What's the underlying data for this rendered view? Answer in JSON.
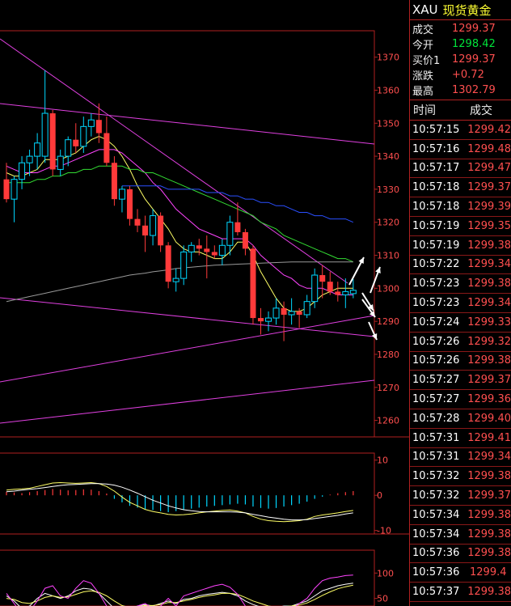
{
  "header": {
    "symbol": "XAU",
    "name": "现货黄金"
  },
  "quote": [
    {
      "label": "成交",
      "value": "1299.37",
      "color": "red"
    },
    {
      "label": "今开",
      "value": "1298.42",
      "color": "green"
    },
    {
      "label": "买价1",
      "value": "1299.37",
      "color": "red"
    },
    {
      "label": "涨跌",
      "value": "+0.72",
      "color": "red"
    },
    {
      "label": "最高",
      "value": "1302.79",
      "color": "red"
    }
  ],
  "ticks_header": {
    "time": "时间",
    "price": "成交"
  },
  "ticks": [
    {
      "time": "10:57:15",
      "price": "1299.42"
    },
    {
      "time": "10:57:16",
      "price": "1299.48"
    },
    {
      "time": "10:57:17",
      "price": "1299.47"
    },
    {
      "time": "10:57:18",
      "price": "1299.37"
    },
    {
      "time": "10:57:18",
      "price": "1299.39"
    },
    {
      "time": "10:57:19",
      "price": "1299.35"
    },
    {
      "time": "10:57:19",
      "price": "1299.38"
    },
    {
      "time": "10:57:22",
      "price": "1299.34"
    },
    {
      "time": "10:57:23",
      "price": "1299.38"
    },
    {
      "time": "10:57:23",
      "price": "1299.34"
    },
    {
      "time": "10:57:24",
      "price": "1299.33"
    },
    {
      "time": "10:57:26",
      "price": "1299.32"
    },
    {
      "time": "10:57:26",
      "price": "1299.38"
    },
    {
      "time": "10:57:27",
      "price": "1299.37"
    },
    {
      "time": "10:57:27",
      "price": "1299.36"
    },
    {
      "time": "10:57:28",
      "price": "1299.40"
    },
    {
      "time": "10:57:31",
      "price": "1299.41"
    },
    {
      "time": "10:57:31",
      "price": "1299.34"
    },
    {
      "time": "10:57:32",
      "price": "1299.38"
    },
    {
      "time": "10:57:32",
      "price": "1299.37"
    },
    {
      "time": "10:57:34",
      "price": "1299.38"
    },
    {
      "time": "10:57:34",
      "price": "1299.38"
    },
    {
      "time": "10:57:36",
      "price": "1299.38"
    },
    {
      "time": "10:57:36",
      "price": "1299.4"
    },
    {
      "time": "10:57:37",
      "price": "1299.38"
    }
  ],
  "colors": {
    "up": "#00d7ff",
    "down": "#ff3a3a",
    "border": "#b02020",
    "trend": "#e040e0",
    "quote_red": "#ff4f4f",
    "quote_green": "#00e43a"
  },
  "chart_data": [
    {
      "type": "candlestick",
      "title": "",
      "ylim": [
        1255,
        1378
      ],
      "y_ticks": [
        1260,
        1270,
        1280,
        1290,
        1300,
        1310,
        1320,
        1330,
        1340,
        1350,
        1360,
        1370
      ],
      "grid": false,
      "candles": [
        {
          "o": 1333,
          "h": 1338,
          "l": 1326,
          "c": 1327
        },
        {
          "o": 1327,
          "h": 1334,
          "l": 1320,
          "c": 1333
        },
        {
          "o": 1333,
          "h": 1340,
          "l": 1330,
          "c": 1338
        },
        {
          "o": 1338,
          "h": 1342,
          "l": 1334,
          "c": 1340
        },
        {
          "o": 1340,
          "h": 1347,
          "l": 1336,
          "c": 1344
        },
        {
          "o": 1340,
          "h": 1366,
          "l": 1338,
          "c": 1353
        },
        {
          "o": 1353,
          "h": 1354,
          "l": 1334,
          "c": 1336
        },
        {
          "o": 1336,
          "h": 1342,
          "l": 1334,
          "c": 1340
        },
        {
          "o": 1340,
          "h": 1346,
          "l": 1337,
          "c": 1345
        },
        {
          "o": 1345,
          "h": 1350,
          "l": 1341,
          "c": 1343
        },
        {
          "o": 1343,
          "h": 1352,
          "l": 1341,
          "c": 1349
        },
        {
          "o": 1349,
          "h": 1353,
          "l": 1346,
          "c": 1351
        },
        {
          "o": 1351,
          "h": 1356,
          "l": 1344,
          "c": 1347
        },
        {
          "o": 1347,
          "h": 1352,
          "l": 1337,
          "c": 1338
        },
        {
          "o": 1338,
          "h": 1340,
          "l": 1325,
          "c": 1327
        },
        {
          "o": 1327,
          "h": 1331,
          "l": 1323,
          "c": 1330
        },
        {
          "o": 1330,
          "h": 1331,
          "l": 1319,
          "c": 1321
        },
        {
          "o": 1321,
          "h": 1324,
          "l": 1317,
          "c": 1319
        },
        {
          "o": 1319,
          "h": 1322,
          "l": 1311,
          "c": 1316
        },
        {
          "o": 1316,
          "h": 1324,
          "l": 1313,
          "c": 1322
        },
        {
          "o": 1322,
          "h": 1323,
          "l": 1311,
          "c": 1313
        },
        {
          "o": 1313,
          "h": 1314,
          "l": 1300,
          "c": 1302
        },
        {
          "o": 1302,
          "h": 1306,
          "l": 1299,
          "c": 1303
        },
        {
          "o": 1303,
          "h": 1313,
          "l": 1301,
          "c": 1311
        },
        {
          "o": 1311,
          "h": 1314,
          "l": 1308,
          "c": 1313
        },
        {
          "o": 1313,
          "h": 1315,
          "l": 1310,
          "c": 1312
        },
        {
          "o": 1312,
          "h": 1316,
          "l": 1303,
          "c": 1311
        },
        {
          "o": 1311,
          "h": 1313,
          "l": 1309,
          "c": 1310
        },
        {
          "o": 1310,
          "h": 1315,
          "l": 1307,
          "c": 1313
        },
        {
          "o": 1313,
          "h": 1322,
          "l": 1310,
          "c": 1320
        },
        {
          "o": 1320,
          "h": 1326,
          "l": 1316,
          "c": 1317
        },
        {
          "o": 1317,
          "h": 1318,
          "l": 1310,
          "c": 1312
        },
        {
          "o": 1312,
          "h": 1313,
          "l": 1289,
          "c": 1291
        },
        {
          "o": 1291,
          "h": 1294,
          "l": 1286,
          "c": 1290
        },
        {
          "o": 1290,
          "h": 1293,
          "l": 1287,
          "c": 1291
        },
        {
          "o": 1291,
          "h": 1297,
          "l": 1289,
          "c": 1294
        },
        {
          "o": 1294,
          "h": 1296,
          "l": 1284,
          "c": 1292
        },
        {
          "o": 1292,
          "h": 1297,
          "l": 1289,
          "c": 1293
        },
        {
          "o": 1293,
          "h": 1294,
          "l": 1288,
          "c": 1292
        },
        {
          "o": 1292,
          "h": 1298,
          "l": 1291,
          "c": 1296
        },
        {
          "o": 1296,
          "h": 1306,
          "l": 1294,
          "c": 1304
        },
        {
          "o": 1304,
          "h": 1307,
          "l": 1297,
          "c": 1302
        },
        {
          "o": 1302,
          "h": 1305,
          "l": 1298,
          "c": 1299
        },
        {
          "o": 1299,
          "h": 1302,
          "l": 1296,
          "c": 1298
        },
        {
          "o": 1298,
          "h": 1303,
          "l": 1294,
          "c": 1299
        },
        {
          "o": 1298.4,
          "h": 1302.8,
          "l": 1297,
          "c": 1299.4
        }
      ],
      "moving_averages": [
        {
          "color": "#ffff66",
          "values": [
            1335,
            1334,
            1334,
            1335,
            1336,
            1339,
            1339,
            1339,
            1340,
            1341,
            1343,
            1345,
            1346,
            1345,
            1343,
            1340,
            1336,
            1331,
            1327,
            1324,
            1321,
            1318,
            1314,
            1312,
            1311,
            1311,
            1310,
            1309,
            1309,
            1311,
            1314,
            1314,
            1310,
            1305,
            1301,
            1297,
            1294,
            1293,
            1293,
            1294,
            1296,
            1298,
            1299,
            1300,
            1300,
            1300
          ]
        },
        {
          "color": "#ff44ff",
          "values": [
            1337,
            1336,
            1335,
            1335,
            1335,
            1336,
            1337,
            1337,
            1338,
            1339,
            1340,
            1341,
            1342,
            1342,
            1342,
            1341,
            1339,
            1337,
            1335,
            1332,
            1330,
            1327,
            1324,
            1322,
            1320,
            1318,
            1317,
            1316,
            1315,
            1315,
            1315,
            1315,
            1313,
            1310,
            1308,
            1306,
            1304,
            1303,
            1301,
            1300,
            1300,
            1300,
            1299,
            1298,
            1298,
            1298
          ]
        },
        {
          "color": "#33dd33",
          "values": [
            1332,
            1332,
            1332,
            1332,
            1333,
            1333,
            1334,
            1334,
            1335,
            1335,
            1336,
            1336,
            1337,
            1337,
            1337,
            1337,
            1336,
            1336,
            1335,
            1335,
            1334,
            1333,
            1332,
            1331,
            1330,
            1329,
            1328,
            1327,
            1326,
            1325,
            1324,
            1323,
            1322,
            1320,
            1319,
            1318,
            1316,
            1315,
            1314,
            1313,
            1312,
            1311,
            1310,
            1309,
            1309,
            1308
          ]
        },
        {
          "color": "#2a4fff",
          "values": [
            null,
            null,
            null,
            null,
            null,
            null,
            null,
            null,
            null,
            null,
            null,
            null,
            null,
            null,
            null,
            1331,
            1331,
            1331,
            1331,
            1331,
            1331,
            1330,
            1330,
            1330,
            1330,
            1330,
            1329,
            1329,
            1329,
            1328,
            1328,
            1327,
            1327,
            1326,
            1326,
            1325,
            1325,
            1324,
            1323,
            1323,
            1322,
            1322,
            1321,
            1321,
            1321,
            1320
          ]
        },
        {
          "color": "#999999",
          "values": [
            1296,
            1296.5,
            1297,
            1297.5,
            1298,
            1298.5,
            1299,
            1299.5,
            1300,
            1300.5,
            1301,
            1301.5,
            1302,
            1302.5,
            1303,
            1303.5,
            1304,
            1304.3,
            1304.6,
            1305,
            1305.3,
            1305.6,
            1306,
            1306.2,
            1306.4,
            1306.6,
            1306.8,
            1307,
            1307.1,
            1307.2,
            1307.3,
            1307.4,
            1307.5,
            1307.6,
            1307.7,
            1307.8,
            1307.9,
            1308,
            1308,
            1308,
            1308,
            1308,
            1308,
            1308,
            1308,
            1308
          ]
        }
      ]
    },
    {
      "type": "bar",
      "title": "",
      "ylim": [
        -11,
        12
      ],
      "y_ticks": [
        -10,
        0,
        10
      ],
      "histogram": [
        1,
        0.8,
        0.6,
        0.9,
        1.2,
        1.5,
        1.8,
        1.6,
        1.4,
        1.5,
        1.7,
        1.6,
        1.2,
        0.5,
        -1,
        -2,
        -3,
        -3.5,
        -4,
        -4.2,
        -4.5,
        -4.8,
        -4.5,
        -4.2,
        -3.8,
        -3.5,
        -3.2,
        -3,
        -2.8,
        -2.6,
        -2.4,
        -2.6,
        -3.2,
        -3.6,
        -3.8,
        -3.6,
        -3.2,
        -2.8,
        -2.4,
        -1.8,
        -1,
        -0.4,
        0.2,
        0.6,
        0.9,
        1.2
      ],
      "series": [
        {
          "color": "#ffff66",
          "values": [
            1.5,
            1.7,
            1.8,
            2,
            2.5,
            3,
            3.5,
            3.6,
            3.5,
            3.4,
            3.5,
            3.6,
            3.3,
            2.5,
            1.2,
            -0.5,
            -2,
            -3,
            -4,
            -4.6,
            -5,
            -5.4,
            -5.6,
            -5.5,
            -5.3,
            -5,
            -4.7,
            -4.5,
            -4.3,
            -4.2,
            -4.5,
            -5,
            -6,
            -6.8,
            -7.2,
            -7.4,
            -7.5,
            -7.4,
            -7.2,
            -6.8,
            -6,
            -5.6,
            -5.3,
            -5,
            -4.6,
            -4.3
          ]
        },
        {
          "color": "#ffffff",
          "values": [
            1,
            1.2,
            1.5,
            1.7,
            1.9,
            2.2,
            2.5,
            2.8,
            3,
            3.1,
            3.2,
            3.3,
            3.3,
            3.2,
            2.9,
            2.3,
            1.5,
            0.6,
            -0.4,
            -1.4,
            -2.2,
            -3,
            -3.6,
            -4.1,
            -4.4,
            -4.6,
            -4.7,
            -4.7,
            -4.7,
            -4.7,
            -4.8,
            -5,
            -5.4,
            -5.8,
            -6.2,
            -6.5,
            -6.8,
            -7,
            -7,
            -6.9,
            -6.6,
            -6.3,
            -6,
            -5.7,
            -5.3,
            -5
          ]
        }
      ]
    },
    {
      "type": "line",
      "title": "",
      "ylim": [
        0,
        110
      ],
      "y_ticks": [
        50,
        100
      ],
      "series": [
        {
          "color": "#ffffff",
          "values": [
            55,
            45,
            30,
            35,
            50,
            60,
            55,
            50,
            55,
            65,
            70,
            68,
            60,
            45,
            30,
            25,
            30,
            35,
            38,
            35,
            40,
            45,
            40,
            48,
            50,
            55,
            58,
            60,
            62,
            60,
            55,
            45,
            38,
            33,
            30,
            32,
            35,
            35,
            40,
            45,
            55,
            65,
            70,
            75,
            78,
            80
          ]
        },
        {
          "color": "#ffff66",
          "values": [
            50,
            48,
            42,
            40,
            45,
            52,
            55,
            52,
            53,
            58,
            63,
            65,
            62,
            55,
            45,
            36,
            32,
            33,
            36,
            36,
            38,
            42,
            42,
            45,
            48,
            52,
            55,
            57,
            60,
            60,
            58,
            52,
            45,
            40,
            35,
            33,
            34,
            35,
            37,
            41,
            48,
            56,
            63,
            69,
            73,
            76
          ]
        },
        {
          "color": "#ff44ff",
          "values": [
            60,
            40,
            20,
            25,
            45,
            70,
            75,
            55,
            50,
            70,
            85,
            80,
            60,
            35,
            15,
            10,
            20,
            35,
            40,
            30,
            35,
            50,
            35,
            55,
            60,
            65,
            70,
            75,
            78,
            72,
            58,
            35,
            25,
            20,
            15,
            20,
            30,
            28,
            40,
            50,
            70,
            85,
            90,
            92,
            95,
            96
          ]
        }
      ]
    }
  ]
}
